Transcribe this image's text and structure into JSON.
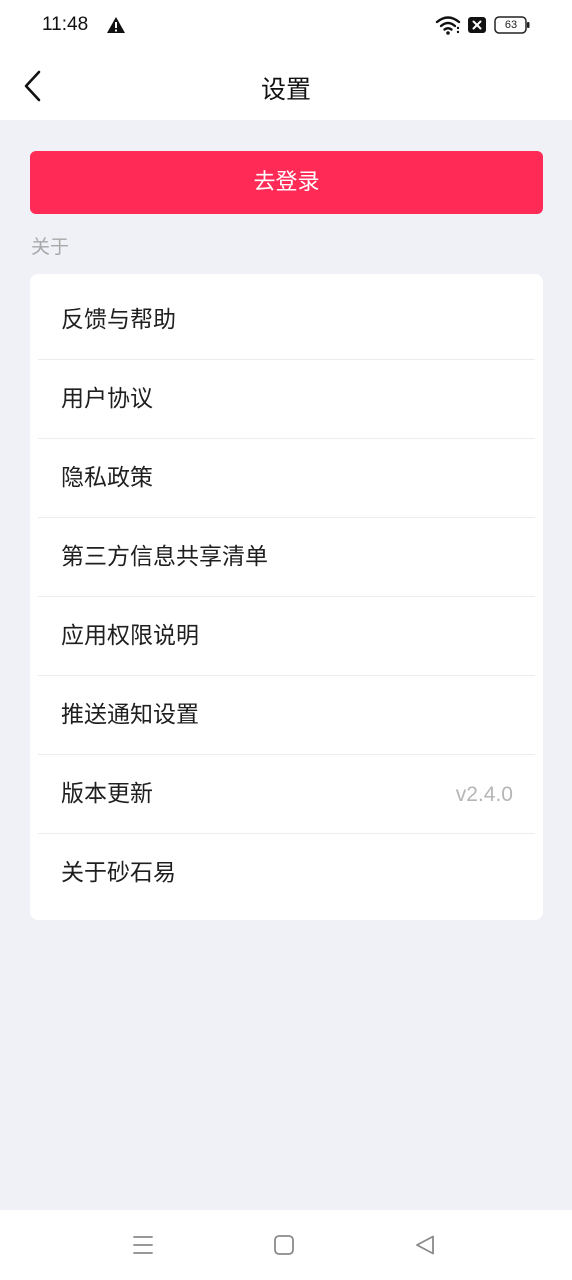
{
  "status_bar": {
    "time": "11:48",
    "battery": "63",
    "icons": [
      "warning-icon",
      "wifi-icon",
      "close-box-icon",
      "battery-icon"
    ]
  },
  "header": {
    "title": "设置",
    "back_icon": "chevron-left-icon"
  },
  "login_button": {
    "label": "去登录",
    "color": "#ff2a56"
  },
  "section": {
    "label": "关于"
  },
  "menu_items": [
    {
      "label": "反馈与帮助",
      "value": ""
    },
    {
      "label": "用户协议",
      "value": ""
    },
    {
      "label": "隐私政策",
      "value": ""
    },
    {
      "label": "第三方信息共享清单",
      "value": ""
    },
    {
      "label": "应用权限说明",
      "value": ""
    },
    {
      "label": "推送通知设置",
      "value": ""
    },
    {
      "label": "版本更新",
      "value": "v2.4.0"
    },
    {
      "label": "关于砂石易",
      "value": ""
    }
  ],
  "nav_bar": {
    "icons": [
      "menu-icon",
      "home-icon",
      "back-triangle-icon"
    ]
  }
}
